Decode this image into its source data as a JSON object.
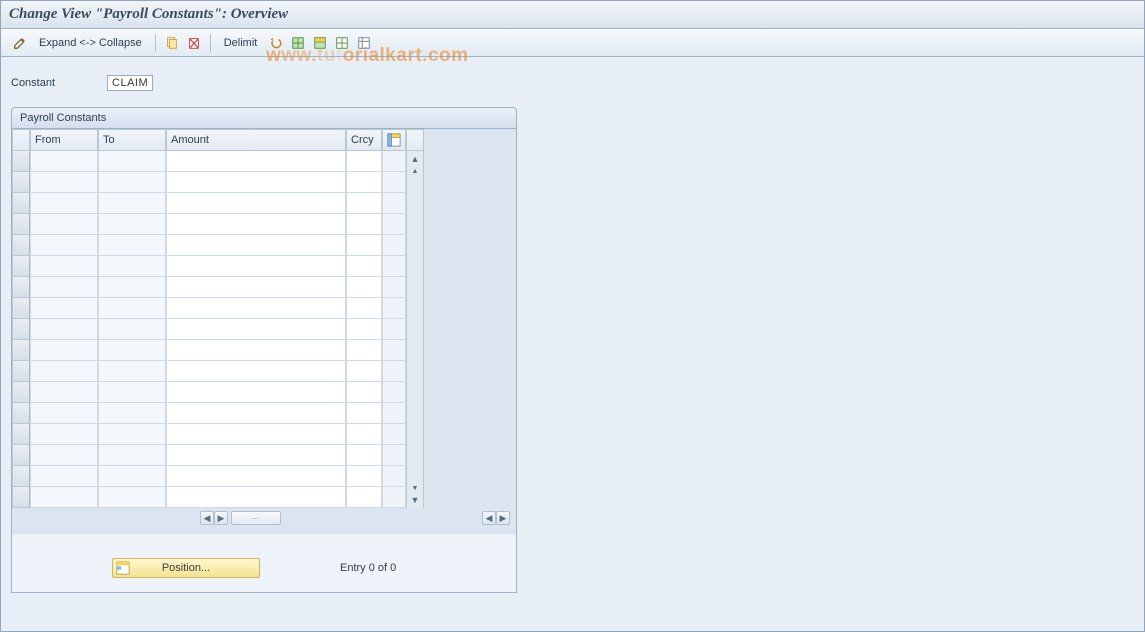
{
  "title": "Change View \"Payroll Constants\": Overview",
  "toolbar": {
    "expand_collapse": "Expand <-> Collapse",
    "delimit": "Delimit"
  },
  "filter": {
    "label": "Constant",
    "value": "CLAIM"
  },
  "panel": {
    "title": "Payroll Constants",
    "columns": {
      "from": "From",
      "to": "To",
      "amount": "Amount",
      "crcy": "Crcy"
    },
    "rows": [
      {
        "from": "",
        "to": "",
        "amount": "",
        "crcy": ""
      },
      {
        "from": "",
        "to": "",
        "amount": "",
        "crcy": ""
      },
      {
        "from": "",
        "to": "",
        "amount": "",
        "crcy": ""
      },
      {
        "from": "",
        "to": "",
        "amount": "",
        "crcy": ""
      },
      {
        "from": "",
        "to": "",
        "amount": "",
        "crcy": ""
      },
      {
        "from": "",
        "to": "",
        "amount": "",
        "crcy": ""
      },
      {
        "from": "",
        "to": "",
        "amount": "",
        "crcy": ""
      },
      {
        "from": "",
        "to": "",
        "amount": "",
        "crcy": ""
      },
      {
        "from": "",
        "to": "",
        "amount": "",
        "crcy": ""
      },
      {
        "from": "",
        "to": "",
        "amount": "",
        "crcy": ""
      },
      {
        "from": "",
        "to": "",
        "amount": "",
        "crcy": ""
      },
      {
        "from": "",
        "to": "",
        "amount": "",
        "crcy": ""
      },
      {
        "from": "",
        "to": "",
        "amount": "",
        "crcy": ""
      },
      {
        "from": "",
        "to": "",
        "amount": "",
        "crcy": ""
      },
      {
        "from": "",
        "to": "",
        "amount": "",
        "crcy": ""
      },
      {
        "from": "",
        "to": "",
        "amount": "",
        "crcy": ""
      },
      {
        "from": "",
        "to": "",
        "amount": "",
        "crcy": ""
      }
    ]
  },
  "footer": {
    "position_label": "Position...",
    "entry_text": "Entry 0 of 0"
  },
  "watermark_suffix": "orialkart.com"
}
